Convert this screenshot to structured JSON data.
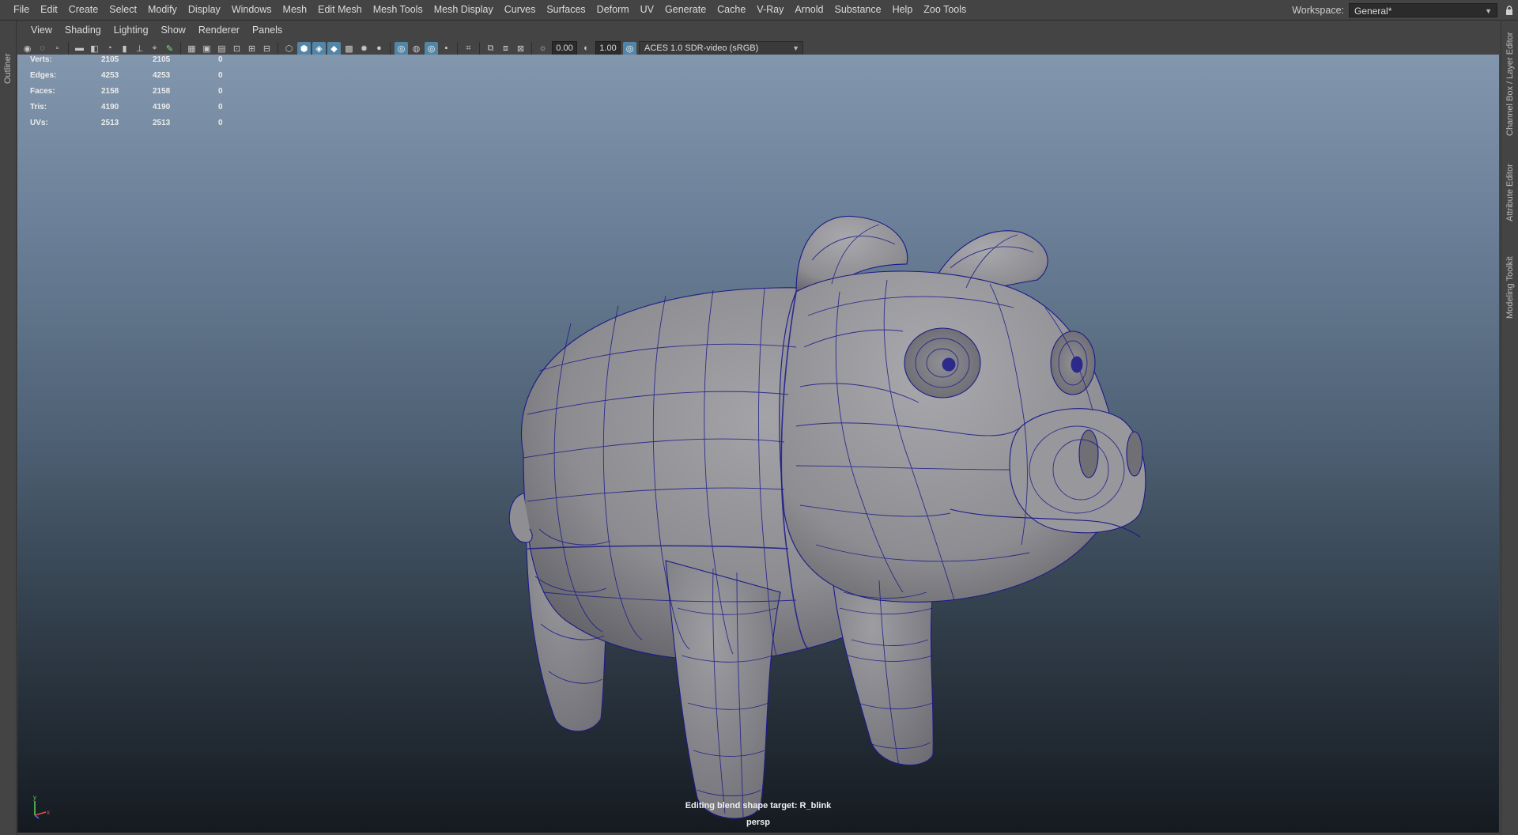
{
  "menubar": {
    "items": [
      "File",
      "Edit",
      "Create",
      "Select",
      "Modify",
      "Display",
      "Windows",
      "Mesh",
      "Edit Mesh",
      "Mesh Tools",
      "Mesh Display",
      "Curves",
      "Surfaces",
      "Deform",
      "UV",
      "Generate",
      "Cache",
      "V-Ray",
      "Arnold",
      "Substance",
      "Help",
      "Zoo Tools"
    ],
    "workspace_label": "Workspace:",
    "workspace_value": "General*"
  },
  "left_strip": {
    "tab": "Outliner"
  },
  "right_strip": {
    "tabs": [
      "Channel Box / Layer Editor",
      "Attribute Editor",
      "Modeling Toolkit"
    ]
  },
  "panel": {
    "menu": [
      "View",
      "Shading",
      "Lighting",
      "Show",
      "Renderer",
      "Panels"
    ],
    "toolbar": {
      "exposure": "0.00",
      "gamma": "1.00",
      "color_space": "ACES 1.0 SDR-video (sRGB)"
    }
  },
  "viewport": {
    "stats": [
      {
        "label": "Verts:",
        "a": "2105",
        "b": "2105",
        "c": "0"
      },
      {
        "label": "Edges:",
        "a": "4253",
        "b": "4253",
        "c": "0"
      },
      {
        "label": "Faces:",
        "a": "2158",
        "b": "2158",
        "c": "0"
      },
      {
        "label": "Tris:",
        "a": "4190",
        "b": "4190",
        "c": "0"
      },
      {
        "label": "UVs:",
        "a": "2513",
        "b": "2513",
        "c": "0"
      }
    ],
    "message": "Editing blend shape target: R_blink",
    "camera": "persp",
    "axis_y": "y",
    "axis_x": "x"
  },
  "colors": {
    "wire": "#1c1a8a",
    "mesh": "#8f8f94",
    "ui_bg": "#444444",
    "highlight": "#5285a6"
  }
}
